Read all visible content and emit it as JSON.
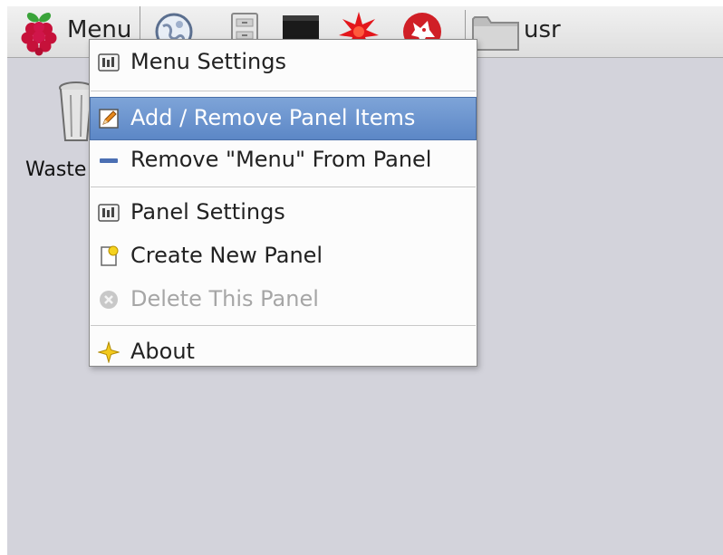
{
  "panel": {
    "menu_label": "Menu",
    "launchers": [
      {
        "icon": "web-browser-icon"
      },
      {
        "icon": "file-manager-icon"
      },
      {
        "icon": "terminal-icon"
      },
      {
        "icon": "mathematica-icon"
      },
      {
        "icon": "wolfram-icon"
      }
    ],
    "folder_label": "usr"
  },
  "desktop": {
    "trash_label": "Waste"
  },
  "context_menu": {
    "items": [
      {
        "label": "Menu Settings",
        "icon": "settings-icon",
        "state": "normal"
      },
      {
        "label": "Add / Remove Panel Items",
        "icon": "edit-icon",
        "state": "active"
      },
      {
        "label": "Remove \"Menu\" From Panel",
        "icon": "remove-icon",
        "state": "normal"
      },
      {
        "label": "Panel Settings",
        "icon": "settings-icon",
        "state": "normal"
      },
      {
        "label": "Create New Panel",
        "icon": "new-document-icon",
        "state": "normal"
      },
      {
        "label": "Delete This Panel",
        "icon": "delete-icon",
        "state": "disabled"
      },
      {
        "label": "About",
        "icon": "star-icon",
        "state": "normal"
      }
    ]
  },
  "colors": {
    "desktop_bg": "#d3d3db",
    "highlight": "#6b93cf",
    "disabled_text": "#a6a6a6"
  }
}
